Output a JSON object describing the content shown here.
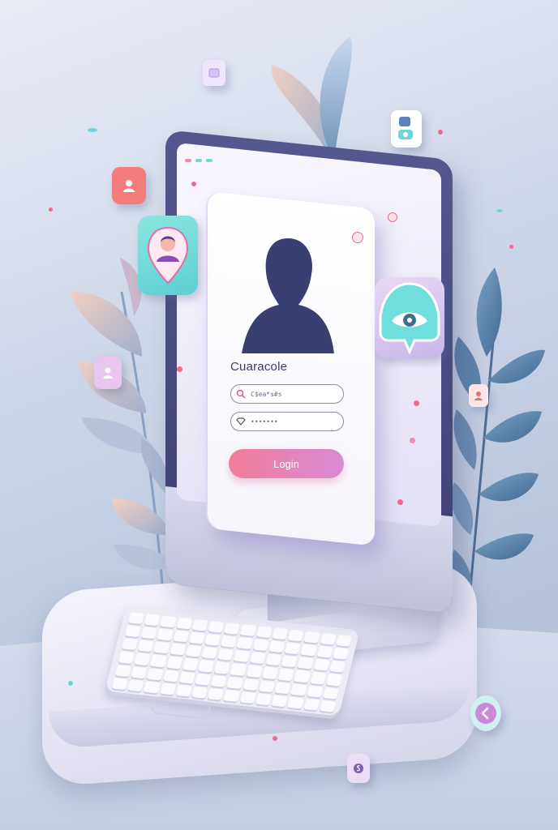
{
  "login_card": {
    "title": "Cuaracole",
    "username_placeholder": "C$ea*s#s",
    "password_placeholder": "•••••••",
    "login_label": "Login"
  },
  "icons": {
    "user_tile": "user-icon",
    "profile_tile": "profile-pin-icon",
    "eye_tile": "eye-pin-icon",
    "app_tile_top": "window-icon",
    "app_tile_right": "contacts-icon",
    "person_tile_left": "person-icon",
    "person_tile_right": "person-icon",
    "back_button": "chevron-left-icon",
    "bottom_tile": "dollar-icon"
  },
  "colors": {
    "accent_pink": "#f27c98",
    "accent_purple": "#d88ad6",
    "teal": "#6fd6d8",
    "navy": "#3d3f72"
  }
}
